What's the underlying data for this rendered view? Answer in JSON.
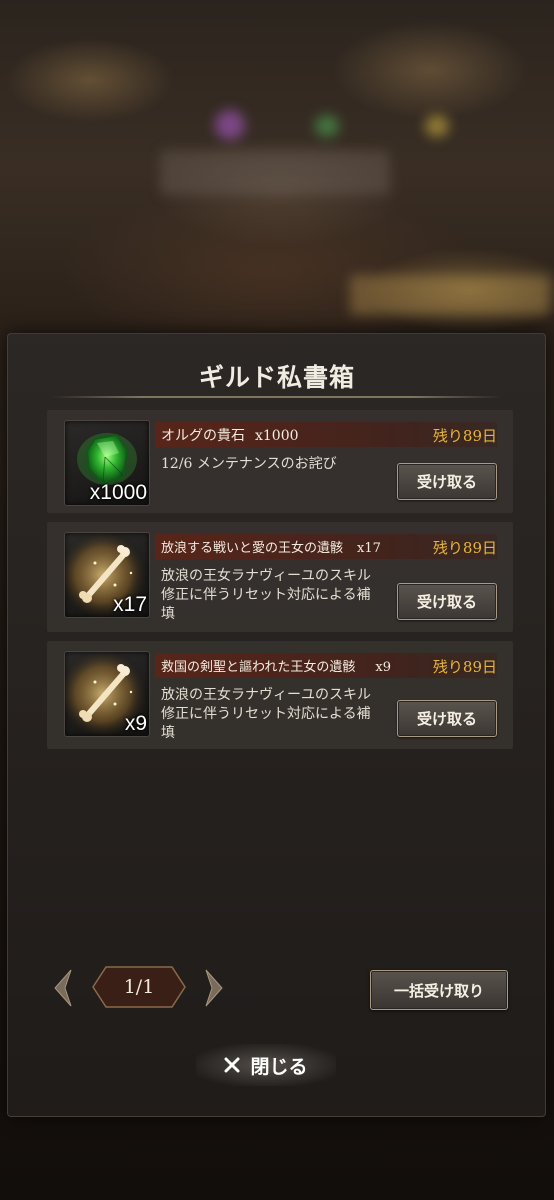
{
  "dialog": {
    "title": "ギルド私書箱"
  },
  "mails": [
    {
      "item_name": "オルグの貴石",
      "item_mult": "x1000",
      "remaining": "残り89日",
      "description": "12/6 メンテナンスのお詫び",
      "icon_qty": "x1000",
      "icon": "green-gem-icon",
      "claim_label": "受け取る"
    },
    {
      "item_name": "放浪する戦いと愛の王女の遺骸",
      "item_mult": "x17",
      "remaining": "残り89日",
      "description": "放浪の王女ラナヴィーユのスキル修正に伴うリセット対応による補填",
      "icon_qty": "x17",
      "icon": "bone-relic-icon",
      "claim_label": "受け取る"
    },
    {
      "item_name": "救国の剣聖と謳われた王女の遺骸",
      "item_mult": "x9",
      "remaining": "残り89日",
      "description": "放浪の王女ラナヴィーユのスキル修正に伴うリセット対応による補填",
      "icon_qty": "x9",
      "icon": "bone-relic-icon",
      "claim_label": "受け取る"
    }
  ],
  "pager": {
    "page": "1/1"
  },
  "bulk_claim_label": "一括受け取り",
  "close_label": "閉じる",
  "colors": {
    "remaining_text": "#e8b53a",
    "header_band": "#5c2418",
    "gem": "#3fbf3f"
  }
}
